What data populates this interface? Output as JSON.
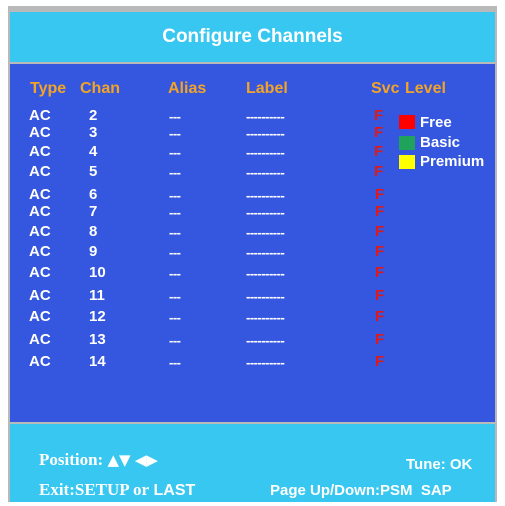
{
  "title": "Configure Channels",
  "headers": {
    "type": "Type",
    "chan": "Chan",
    "alias": "Alias",
    "label": "Label",
    "svc": "Svc",
    "level": "Level"
  },
  "rows": [
    {
      "type": "AC",
      "chan": "2",
      "alias": "---",
      "label": "----------",
      "svc": "F"
    },
    {
      "type": "AC",
      "chan": "3",
      "alias": "---",
      "label": "----------",
      "svc": "F"
    },
    {
      "type": "AC",
      "chan": "4",
      "alias": "---",
      "label": "----------",
      "svc": "F"
    },
    {
      "type": "AC",
      "chan": "5",
      "alias": "---",
      "label": "----------",
      "svc": "F"
    },
    {
      "type": "AC",
      "chan": "6",
      "alias": "---",
      "label": "----------",
      "svc": "F"
    },
    {
      "type": "AC",
      "chan": "7",
      "alias": "---",
      "label": "----------",
      "svc": "F"
    },
    {
      "type": "AC",
      "chan": "8",
      "alias": "---",
      "label": "----------",
      "svc": "F"
    },
    {
      "type": "AC",
      "chan": "9",
      "alias": "---",
      "label": "----------",
      "svc": "F"
    },
    {
      "type": "AC",
      "chan": "10",
      "alias": "---",
      "label": "----------",
      "svc": "F"
    },
    {
      "type": "AC",
      "chan": "11",
      "alias": "---",
      "label": "----------",
      "svc": "F"
    },
    {
      "type": "AC",
      "chan": "12",
      "alias": "---",
      "label": "----------",
      "svc": "F"
    },
    {
      "type": "AC",
      "chan": "13",
      "alias": "---",
      "label": "----------",
      "svc": "F"
    },
    {
      "type": "AC",
      "chan": "14",
      "alias": "---",
      "label": "----------",
      "svc": "F"
    }
  ],
  "legend": [
    {
      "label": "Free",
      "color": "#ff0000"
    },
    {
      "label": "Basic",
      "color": "#1fa35a"
    },
    {
      "label": "Premium",
      "color": "#ffff00"
    }
  ],
  "footer": {
    "position_label": "Position:",
    "exit_label": "Exit:",
    "exit_keys": "SETUP or",
    "exit_last": "LAST",
    "tune": "Tune: OK",
    "page": "Page Up/Down:PSM  SAP"
  },
  "colors": {
    "header_text": "#f3a326",
    "svc_text": "#e01818",
    "panel": "#3557e0",
    "bar": "#37c7f0"
  }
}
